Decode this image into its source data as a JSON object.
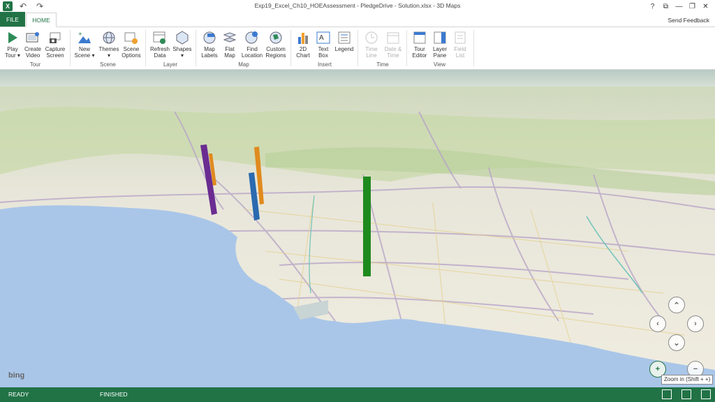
{
  "titlebar": {
    "app_icon": "X",
    "undo_icon": "↶",
    "redo_icon": "↷",
    "title": "Exp19_Excel_Ch10_HOEAssessment - PledgeDrive - Solution.xlsx - 3D Maps",
    "help": "?",
    "restore_icon": "⧉",
    "minimize": "—",
    "maximize": "❐",
    "close": "✕"
  },
  "tabs": {
    "file": "FILE",
    "home": "HOME",
    "send_feedback": "Send Feedback"
  },
  "ribbon": {
    "tour": {
      "label": "Tour",
      "play_tour": [
        "Play",
        "Tour ▾"
      ],
      "create_video": [
        "Create",
        "Video"
      ],
      "capture_screen": [
        "Capture",
        "Screen"
      ]
    },
    "scene": {
      "label": "Scene",
      "new_scene": [
        "New",
        "Scene ▾"
      ],
      "themes": [
        "Themes",
        "▾"
      ],
      "scene_options": [
        "Scene",
        "Options"
      ]
    },
    "layer": {
      "label": "Layer",
      "refresh_data": [
        "Refresh",
        "Data"
      ],
      "shapes": [
        "Shapes",
        "▾"
      ]
    },
    "map": {
      "label": "Map",
      "map_labels": [
        "Map",
        "Labels"
      ],
      "flat_map": [
        "Flat",
        "Map"
      ],
      "find_location": [
        "Find",
        "Location"
      ],
      "custom_regions": [
        "Custom",
        "Regions"
      ]
    },
    "insert": {
      "label": "Insert",
      "chart_2d": [
        "2D",
        "Chart"
      ],
      "text_box": [
        "Text",
        "Box"
      ],
      "legend": [
        "Legend",
        ""
      ]
    },
    "time": {
      "label": "Time",
      "time_line": [
        "Time",
        "Line"
      ],
      "date_time": [
        "Date &",
        "Time"
      ]
    },
    "view": {
      "label": "View",
      "tour_editor": [
        "Tour",
        "Editor"
      ],
      "layer_pane": [
        "Layer",
        "Pane"
      ],
      "field_list": [
        "Field",
        "List"
      ]
    }
  },
  "map": {
    "bing": "bing",
    "zoom_tooltip": "Zoom in (Shift + +)",
    "nav": {
      "up": "⌃",
      "left": "‹",
      "right": "›",
      "down": "⌄",
      "zoom_in": "+",
      "zoom_out": "−"
    },
    "colors": {
      "purple": "#6a2c91",
      "orange": "#e08a1e",
      "blue": "#2a6ab0",
      "green": "#1e8a1e",
      "ocean": "#a9c6e8"
    }
  },
  "status": {
    "ready": "READY",
    "finished": "FINISHED"
  }
}
